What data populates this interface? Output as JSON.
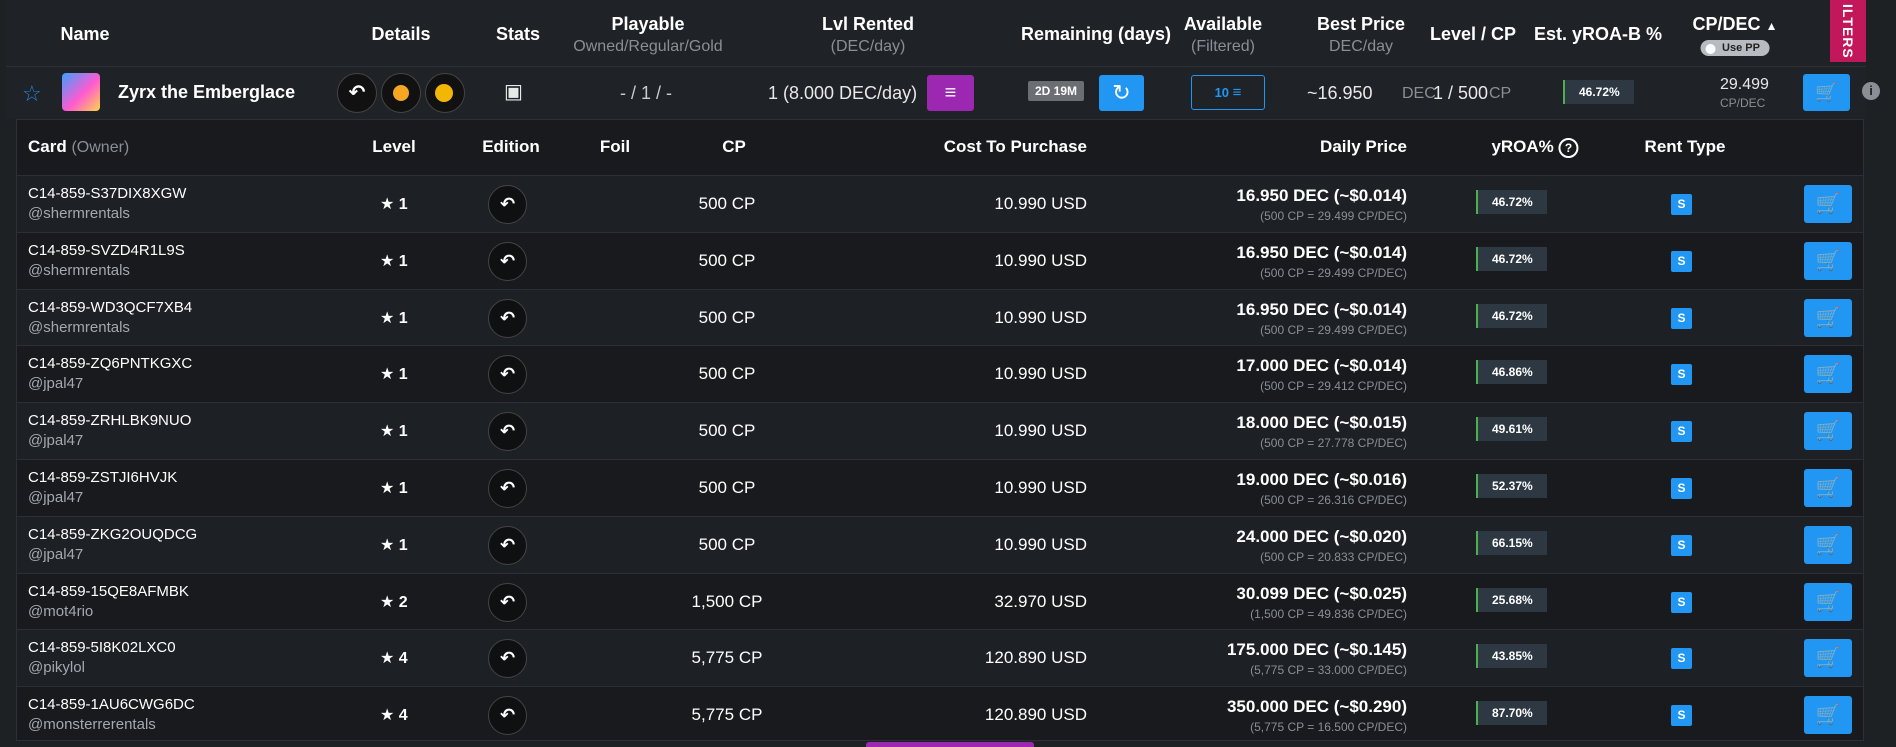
{
  "header": {
    "name": "Name",
    "details": "Details",
    "stats": "Stats",
    "playable": "Playable",
    "playable_sub": "Owned/Regular/Gold",
    "lvl_rented": "Lvl Rented",
    "lvl_rented_sub": "(DEC/day)",
    "remaining": "Remaining (days)",
    "available": "Available",
    "available_sub": "(Filtered)",
    "best_price": "Best Price",
    "best_price_sub": "DEC/day",
    "level_cp": "Level / CP",
    "est_yroa": "Est. yROA-B %",
    "cp_dec": "CP/DEC",
    "cp_dec_arrow": "▲",
    "use_pp": "Use PP",
    "filters": "ILTERS"
  },
  "card": {
    "name": "Zyrx the Emberglace",
    "playable": "- / 1 / -",
    "lvl_rented": "1 (8.000 DEC/day)",
    "remaining_badge": "2D 19M",
    "available": "10",
    "best_price": "~16.950",
    "best_price_unit": "DEC",
    "level": "1 / 500",
    "level_unit": "CP",
    "est_yroa": "46.72%",
    "cp_dec": "29.499",
    "cp_dec_unit": "CP/DEC",
    "star_icon": "☆",
    "gold_icon": "✦",
    "edition_glyph": "↶",
    "stats_glyph": "▣",
    "stack_glyph": "≡",
    "refresh_glyph": "↻",
    "cart_glyph": "🛒",
    "info_glyph": "i"
  },
  "table": {
    "headers": {
      "card": "Card",
      "owner": "(Owner)",
      "level": "Level",
      "edition": "Edition",
      "foil": "Foil",
      "cp": "CP",
      "cost": "Cost To Purchase",
      "daily": "Daily Price",
      "yroa": "yROA%",
      "yroa_help": "?",
      "rent_type": "Rent Type"
    },
    "rows": [
      {
        "id": "C14-859-S37DIX8XGW",
        "owner": "@shermrentals",
        "level": "1",
        "cp": "500 CP",
        "cost": "10.990 USD",
        "daily": "16.950 DEC (~$0.014)",
        "daily_sub": "(500 CP = 29.499 CP/DEC)",
        "yroa": "46.72%",
        "rent": "S"
      },
      {
        "id": "C14-859-SVZD4R1L9S",
        "owner": "@shermrentals",
        "level": "1",
        "cp": "500 CP",
        "cost": "10.990 USD",
        "daily": "16.950 DEC (~$0.014)",
        "daily_sub": "(500 CP = 29.499 CP/DEC)",
        "yroa": "46.72%",
        "rent": "S"
      },
      {
        "id": "C14-859-WD3QCF7XB4",
        "owner": "@shermrentals",
        "level": "1",
        "cp": "500 CP",
        "cost": "10.990 USD",
        "daily": "16.950 DEC (~$0.014)",
        "daily_sub": "(500 CP = 29.499 CP/DEC)",
        "yroa": "46.72%",
        "rent": "S"
      },
      {
        "id": "C14-859-ZQ6PNTKGXC",
        "owner": "@jpal47",
        "level": "1",
        "cp": "500 CP",
        "cost": "10.990 USD",
        "daily": "17.000 DEC (~$0.014)",
        "daily_sub": "(500 CP = 29.412 CP/DEC)",
        "yroa": "46.86%",
        "rent": "S"
      },
      {
        "id": "C14-859-ZRHLBK9NUO",
        "owner": "@jpal47",
        "level": "1",
        "cp": "500 CP",
        "cost": "10.990 USD",
        "daily": "18.000 DEC (~$0.015)",
        "daily_sub": "(500 CP = 27.778 CP/DEC)",
        "yroa": "49.61%",
        "rent": "S"
      },
      {
        "id": "C14-859-ZSTJI6HVJK",
        "owner": "@jpal47",
        "level": "1",
        "cp": "500 CP",
        "cost": "10.990 USD",
        "daily": "19.000 DEC (~$0.016)",
        "daily_sub": "(500 CP = 26.316 CP/DEC)",
        "yroa": "52.37%",
        "rent": "S"
      },
      {
        "id": "C14-859-ZKG2OUQDCG",
        "owner": "@jpal47",
        "level": "1",
        "cp": "500 CP",
        "cost": "10.990 USD",
        "daily": "24.000 DEC (~$0.020)",
        "daily_sub": "(500 CP = 20.833 CP/DEC)",
        "yroa": "66.15%",
        "rent": "S"
      },
      {
        "id": "C14-859-15QE8AFMBK",
        "owner": "@mot4rio",
        "level": "2",
        "cp": "1,500 CP",
        "cost": "32.970 USD",
        "daily": "30.099 DEC (~$0.025)",
        "daily_sub": "(1,500 CP = 49.836 CP/DEC)",
        "yroa": "25.68%",
        "rent": "S"
      },
      {
        "id": "C14-859-5I8K02LXC0",
        "owner": "@pikylol",
        "level": "4",
        "cp": "5,775 CP",
        "cost": "120.890 USD",
        "daily": "175.000 DEC (~$0.145)",
        "daily_sub": "(5,775 CP = 33.000 CP/DEC)",
        "yroa": "43.85%",
        "rent": "S"
      },
      {
        "id": "C14-859-1AU6CWG6DC",
        "owner": "@monsterrerentals",
        "level": "4",
        "cp": "5,775 CP",
        "cost": "120.890 USD",
        "daily": "350.000 DEC (~$0.290)",
        "daily_sub": "(5,775 CP = 16.500 CP/DEC)",
        "yroa": "87.70%",
        "rent": "S"
      }
    ]
  }
}
